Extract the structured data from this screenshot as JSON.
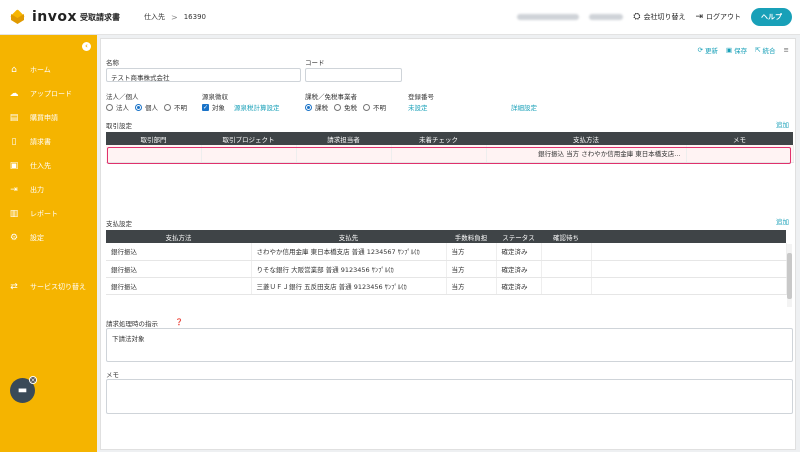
{
  "header": {
    "logo_text": "invox",
    "logo_sub": "受取請求書",
    "breadcrumb_section": "仕入先",
    "breadcrumb_sep": ">",
    "breadcrumb_id": "16390",
    "switch_company_label": "会社切り替え",
    "logout_label": "ログアウト",
    "help_label": "ヘルプ"
  },
  "sidebar": {
    "collapse_icon": "‹",
    "items": [
      {
        "label": "ホーム",
        "icon": "home-icon",
        "glyph": "⌂"
      },
      {
        "label": "アップロード",
        "icon": "upload-icon",
        "glyph": "☁"
      },
      {
        "label": "購買申請",
        "icon": "purchase-icon",
        "glyph": "▤"
      },
      {
        "label": "請求書",
        "icon": "invoice-icon",
        "glyph": "▯"
      },
      {
        "label": "仕入先",
        "icon": "supplier-icon",
        "glyph": "▣"
      },
      {
        "label": "出力",
        "icon": "export-icon",
        "glyph": "⇥"
      },
      {
        "label": "レポート",
        "icon": "report-icon",
        "glyph": "▥"
      },
      {
        "label": "設定",
        "icon": "gear-icon",
        "glyph": "⚙"
      },
      {
        "label": "サービス切り替え",
        "icon": "switch-service-icon",
        "glyph": "⇄"
      }
    ]
  },
  "toolbar": {
    "refresh": "更新",
    "save": "保存",
    "merge": "統合",
    "menu_glyph": "≡"
  },
  "form": {
    "name_label": "名称",
    "name_value": "テスト商事株式会社",
    "code_label": "コード",
    "code_value": "",
    "entity_label": "法人／個人",
    "entity_options": [
      "法人",
      "個人",
      "不明"
    ],
    "entity_selected": "個人",
    "withholding_label": "源泉徴収",
    "withholding_check": "対象",
    "withholding_link": "源泉税計算設定",
    "tax_label": "課税／免税事業者",
    "tax_options": [
      "課税",
      "免税",
      "不明"
    ],
    "tax_selected": "課税",
    "reg_label": "登録番号",
    "reg_value": "未設定",
    "detail_link": "詳細設定"
  },
  "transactions": {
    "title": "取引設定",
    "add": "追加",
    "columns": [
      "取引部門",
      "取引プロジェクト",
      "請求担当者",
      "未着チェック",
      "支払方法",
      "メモ"
    ],
    "rows": [
      [
        "",
        "",
        "",
        "",
        "銀行振込 当方 さわやか信用金庫 東日本橋支店...",
        ""
      ]
    ]
  },
  "payments": {
    "title": "支払設定",
    "add": "追加",
    "columns": [
      "支払方法",
      "支払先",
      "手数料負担",
      "ステータス",
      "確認待ち"
    ],
    "rows": [
      [
        "銀行振込",
        "さわやか信用金庫 東日本橋支店 普通 1234567 ｻﾝﾌﾟﾙ(ｶ",
        "当方",
        "確定済み",
        ""
      ],
      [
        "銀行振込",
        "りそな銀行 大阪営業部 普通 9123456 ｻﾝﾌﾟﾙ(ｶ",
        "当方",
        "確定済み",
        ""
      ],
      [
        "銀行振込",
        "三菱ＵＦＪ銀行 五反田支店 普通 9123456 ｻﾝﾌﾟﾙ(ｶ",
        "当方",
        "確定済み",
        ""
      ]
    ]
  },
  "instructions": {
    "label": "請求処理時の指示",
    "value": "下請法対象"
  },
  "memo": {
    "label": "メモ",
    "value": ""
  },
  "colors": {
    "sidebar": "#f5b400",
    "accent": "#18a0b8",
    "table_header": "#3f4447",
    "highlight": "#e0316c"
  }
}
